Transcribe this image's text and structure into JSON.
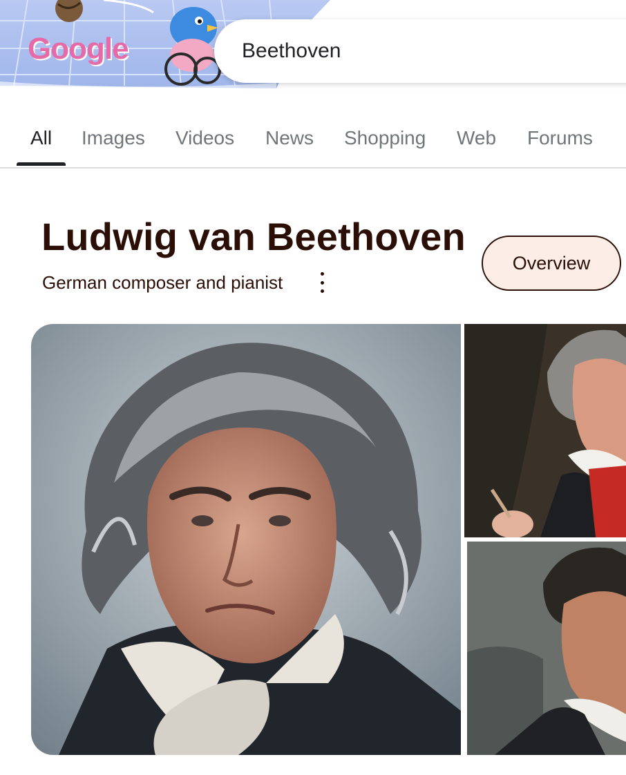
{
  "search": {
    "query": "Beethoven"
  },
  "doodle": {
    "logo_text": "Google"
  },
  "tabs": [
    {
      "label": "All",
      "active": true
    },
    {
      "label": "Images"
    },
    {
      "label": "Videos"
    },
    {
      "label": "News"
    },
    {
      "label": "Shopping"
    },
    {
      "label": "Web"
    },
    {
      "label": "Forums"
    }
  ],
  "knowledge_panel": {
    "title": "Ludwig van Beethoven",
    "subtitle": "German composer and pianist",
    "overview_chip": "Overview",
    "more_icon": "more-vert-icon"
  },
  "images": [
    {
      "name": "portrait-main",
      "icon": "image"
    },
    {
      "name": "portrait-painting-red-scarf",
      "icon": "image"
    },
    {
      "name": "portrait-painting-dark-hair",
      "icon": "image"
    }
  ],
  "colors": {
    "title_text": "#2b0f06",
    "chip_bg": "#fdede7",
    "tab_inactive": "#70757a",
    "tab_active": "#202124"
  }
}
